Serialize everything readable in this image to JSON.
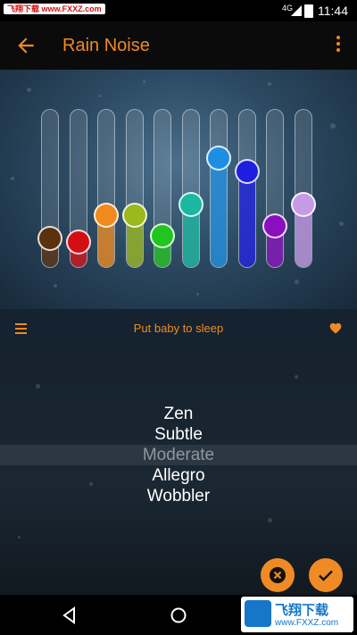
{
  "status_bar": {
    "watermark": "飞翔下载 www.FXXZ.com",
    "network": "4G",
    "time": "11:44"
  },
  "app_bar": {
    "title": "Rain Noise",
    "back_icon": "arrow-left-icon",
    "menu_icon": "more-vert-icon"
  },
  "sliders": [
    {
      "color": "#5a3210",
      "level": 0.13
    },
    {
      "color": "#d40f14",
      "level": 0.1
    },
    {
      "color": "#f08a1c",
      "level": 0.3
    },
    {
      "color": "#9bb81c",
      "level": 0.3
    },
    {
      "color": "#22c51f",
      "level": 0.15
    },
    {
      "color": "#1ab8a0",
      "level": 0.38
    },
    {
      "color": "#1e8fe0",
      "level": 0.73
    },
    {
      "color": "#1e1ee0",
      "level": 0.63
    },
    {
      "color": "#8a0fbf",
      "level": 0.22
    },
    {
      "color": "#c79ae8",
      "level": 0.38
    }
  ],
  "preset_bar": {
    "title": "Put baby to sleep",
    "menu_icon": "hamburger-icon",
    "favorite_icon": "heart-icon"
  },
  "picker": {
    "items": [
      "Zen",
      "Subtle",
      "Moderate",
      "Allegro",
      "Wobbler"
    ],
    "selected": "Moderate"
  },
  "actions": {
    "cancel_icon": "close-circle-icon",
    "confirm_icon": "check-icon"
  },
  "watermark_corner": {
    "text": "飞翔下载",
    "sub": "www.FXXZ.com"
  },
  "colors": {
    "accent": "#f08a24"
  }
}
